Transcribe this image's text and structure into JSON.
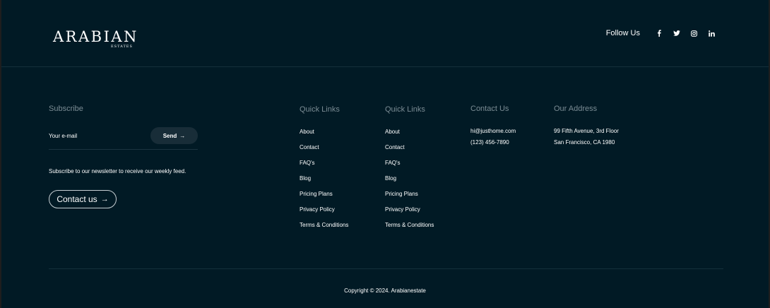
{
  "header": {
    "logo_main": "ARABIAN",
    "logo_sub": "ESTATES",
    "follow_label": "Follow Us",
    "social": [
      "facebook-icon",
      "twitter-icon",
      "instagram-icon",
      "linkedin-icon"
    ]
  },
  "subscribe": {
    "title": "Subscribe",
    "email_placeholder": "Your e-mail",
    "send_label": "Send",
    "description": "Subscribe to our newsletter to receive our weekly feed.",
    "contact_label": "Contact us"
  },
  "quick_links_1": {
    "title": "Quick Links",
    "items": [
      "About",
      "Contact",
      "FAQ's",
      "Blog",
      "Pricing Plans",
      "Privacy Policy",
      "Terms & Conditions"
    ]
  },
  "quick_links_2": {
    "title": "Quick Links",
    "items": [
      "About",
      "Contact",
      "FAQ's",
      "Blog",
      "Pricing Plans",
      "Privacy Policy",
      "Terms & Conditions"
    ]
  },
  "contact": {
    "title": "Contact Us",
    "email": "hi@justhome.com",
    "phone": "(123) 456-7890"
  },
  "address": {
    "title": "Our Address",
    "line1": "99 Fifth Avenue, 3rd Floor",
    "line2": "San Francisco, CA 1980"
  },
  "footer": {
    "copyright": "Copyright © 2024. Arabianestate"
  },
  "colors": {
    "background": "#011a25",
    "muted_heading": "#7b8c94",
    "button_bg": "#182d38"
  }
}
